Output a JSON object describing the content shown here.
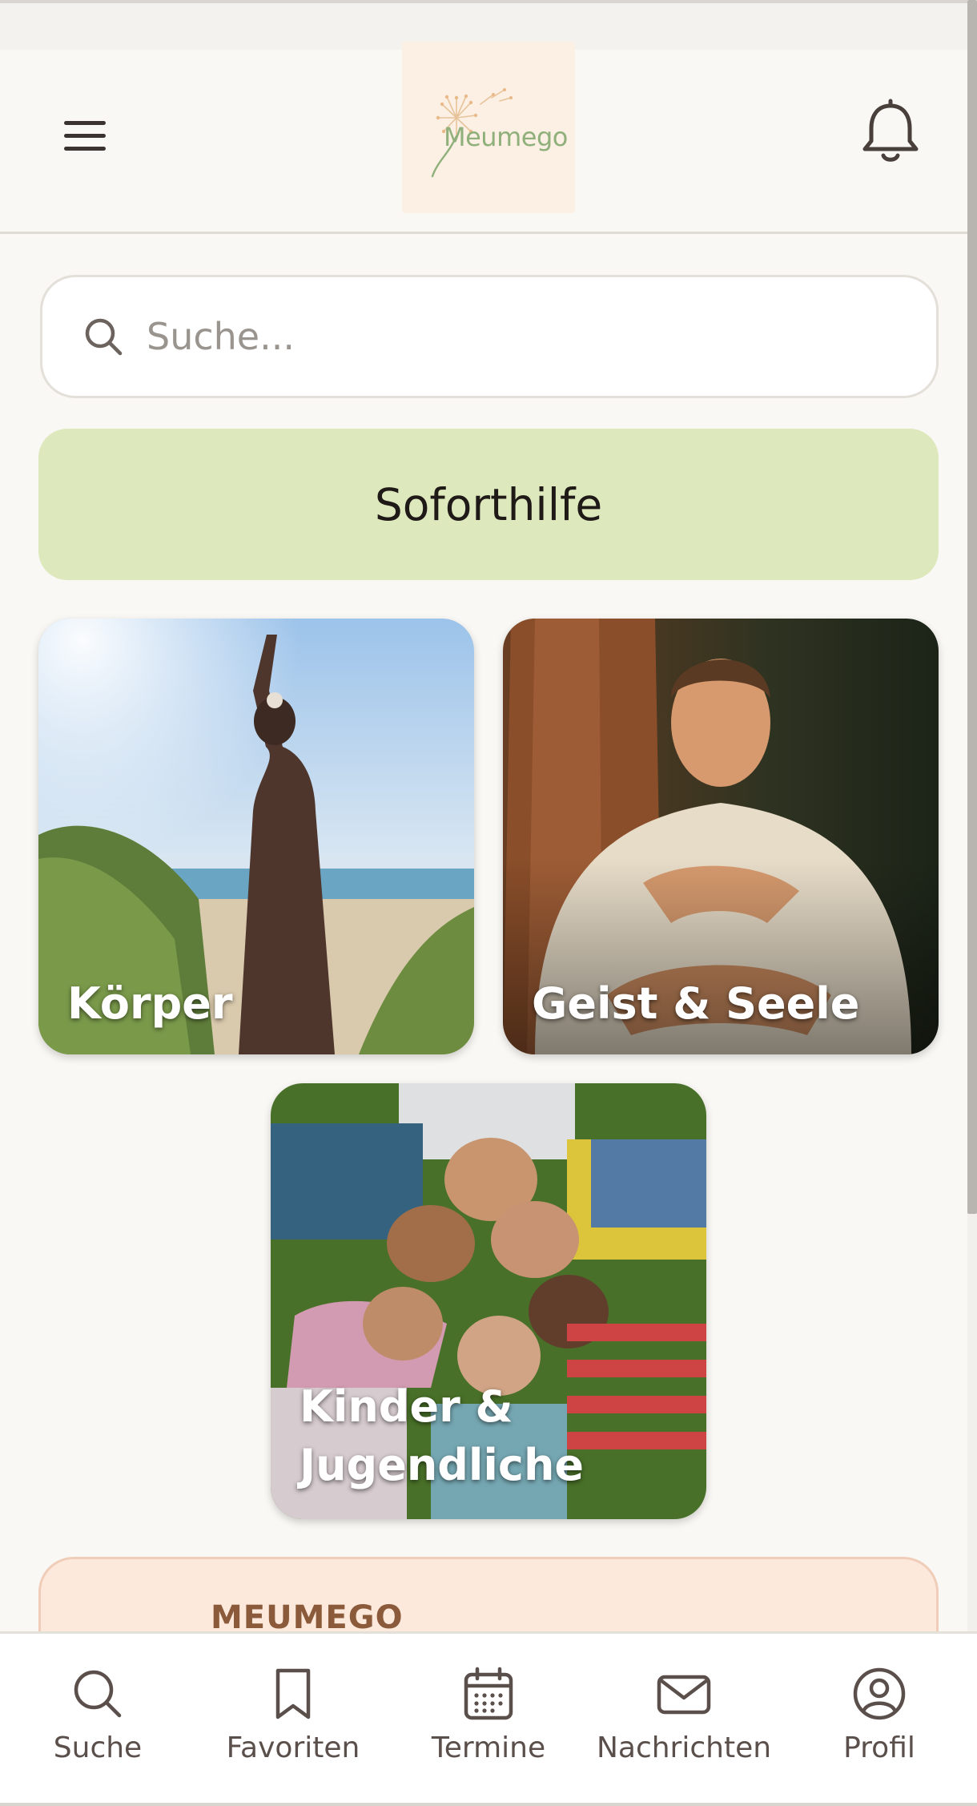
{
  "app": {
    "logo_text": "Meumego"
  },
  "header": {
    "menu_icon": "hamburger-menu-icon",
    "notification_icon": "bell-icon"
  },
  "search": {
    "placeholder": "Suche...",
    "value": ""
  },
  "sofort": {
    "label": "Soforthilfe"
  },
  "categories": [
    {
      "label": "Körper"
    },
    {
      "label": "Geist & Seele"
    },
    {
      "label_line1": "Kinder &",
      "label_line2": "Jugendliche"
    }
  ],
  "promo": {
    "title": "MEUMEGO"
  },
  "nav": {
    "items": [
      {
        "label": "Suche",
        "icon": "search-icon"
      },
      {
        "label": "Favoriten",
        "icon": "bookmark-icon"
      },
      {
        "label": "Termine",
        "icon": "calendar-icon"
      },
      {
        "label": "Nachrichten",
        "icon": "mail-icon"
      },
      {
        "label": "Profil",
        "icon": "user-circle-icon"
      }
    ]
  },
  "colors": {
    "background": "#faf8f4",
    "sofort_bg": "#dde8bd",
    "promo_bg": "#fde9dc",
    "logo_bg": "#fcefe3",
    "logo_green": "#8fb07a",
    "text_dark": "#2c2420"
  }
}
